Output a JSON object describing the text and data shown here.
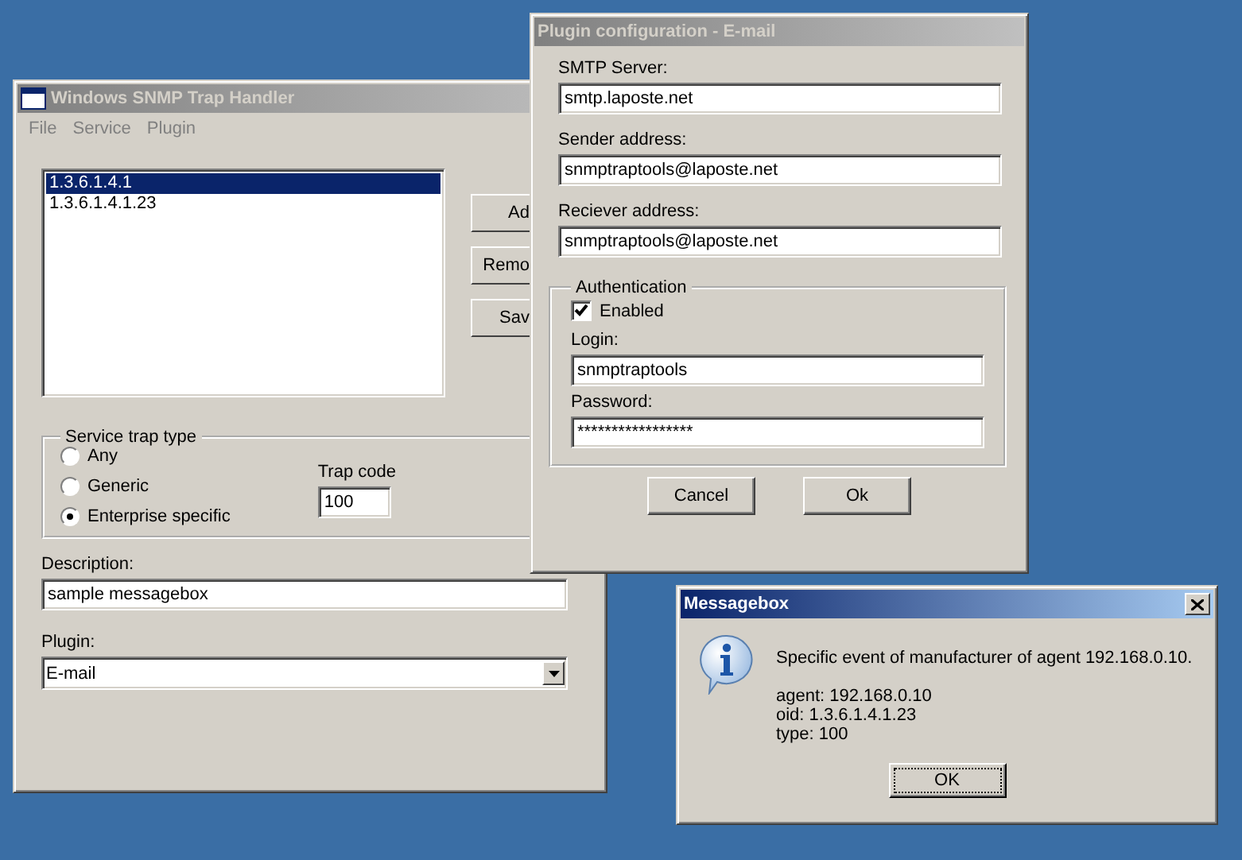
{
  "main_window": {
    "title": "Windows SNMP Trap Handler",
    "active": false,
    "menu": [
      "File",
      "Service",
      "Plugin"
    ],
    "oid_list": [
      {
        "label": "1.3.6.1.4.1",
        "selected": true
      },
      {
        "label": "1.3.6.1.4.1.23",
        "selected": false
      }
    ],
    "buttons": [
      "Ad",
      "Remo",
      "Sav"
    ],
    "trap_type": {
      "title": "Service trap type",
      "options": [
        {
          "label": "Any",
          "selected": false
        },
        {
          "label": "Generic",
          "selected": false
        },
        {
          "label": "Enterprise specific",
          "selected": true
        }
      ],
      "trap_code_label": "Trap code",
      "trap_code": "100"
    },
    "description": {
      "label": "Description:",
      "value": "sample messagebox"
    },
    "plugin": {
      "label": "Plugin:",
      "value": "E-mail"
    }
  },
  "plugin_window": {
    "title": "Plugin configuration - E-mail",
    "active": false,
    "fields": [
      {
        "label": "SMTP Server:",
        "value": "smtp.laposte.net"
      },
      {
        "label": "Sender address:",
        "value": "snmptraptools@laposte.net"
      },
      {
        "label": "Reciever address:",
        "value": "snmptraptools@laposte.net"
      }
    ],
    "authentication": {
      "title": "Authentication",
      "enabled_label": "Enabled",
      "checked": true,
      "login_label": "Login:",
      "login": "snmptraptools",
      "password_label": "Password:",
      "password": "*****************"
    },
    "buttons": [
      "Cancel",
      "Ok"
    ]
  },
  "messagebox": {
    "title": "Messagebox",
    "active": true,
    "message": "Specific event of manufacturer of agent 192.168.0.10.",
    "details": [
      "agent: 192.168.0.10",
      "oid: 1.3.6.1.4.1.23",
      "type: 100"
    ],
    "button": "OK"
  }
}
